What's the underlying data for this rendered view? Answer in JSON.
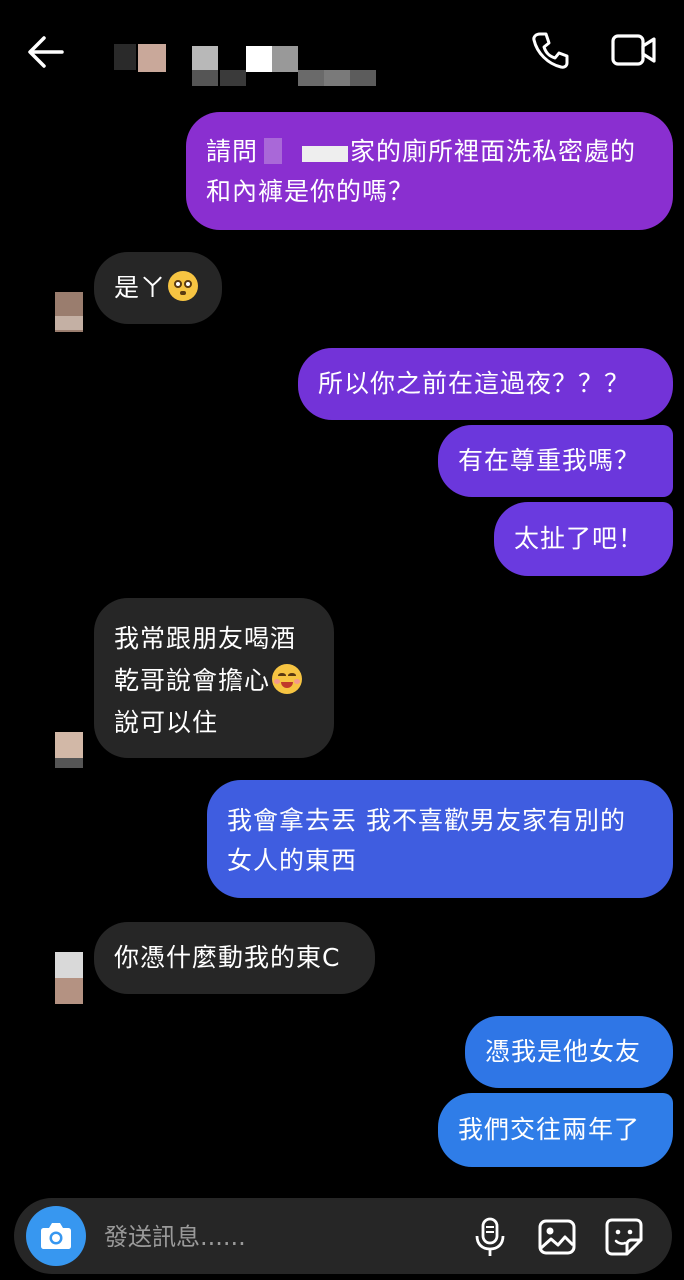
{
  "header": {
    "contact_name": ""
  },
  "messages": [
    {
      "side": "out",
      "lines": [
        "請問",
        "家的廁所裡面洗私密處的",
        "和內褲是你的嗎？"
      ]
    },
    {
      "side": "in",
      "lines": [
        "是ㄚ"
      ],
      "emoji": "flushed-face"
    },
    {
      "side": "out",
      "lines": [
        "所以你之前在這過夜？？？"
      ]
    },
    {
      "side": "out",
      "lines": [
        "有在尊重我嗎？"
      ]
    },
    {
      "side": "out",
      "lines": [
        "太扯了吧！"
      ]
    },
    {
      "side": "in",
      "lines": [
        "我常跟朋友喝酒",
        "乾哥說會擔心",
        "說可以住"
      ],
      "emoji": "smiling-blushing-face"
    },
    {
      "side": "out",
      "lines": [
        "我會拿去丟 我不喜歡男友家有別的",
        "女人的東西"
      ]
    },
    {
      "side": "in",
      "lines": [
        "你憑什麼動我的東C"
      ]
    },
    {
      "side": "out",
      "lines": [
        "憑我是他女友"
      ]
    },
    {
      "side": "out",
      "lines": [
        "我們交往兩年了"
      ]
    }
  ],
  "composer": {
    "placeholder": "發送訊息......"
  },
  "colors": {
    "bubble_purple": "#8a2fd0",
    "bubble_violet": "#6a3adf",
    "bubble_indigo": "#3f5de0",
    "bubble_blue": "#2f7de8",
    "bubble_incoming": "#262626",
    "accent": "#3797f0",
    "background": "#000000"
  },
  "icons": {
    "back": "arrow-left-icon",
    "call": "phone-icon",
    "video": "video-camera-icon",
    "camera": "camera-icon",
    "mic": "microphone-icon",
    "gallery": "image-icon",
    "sticker": "sticker-icon"
  }
}
